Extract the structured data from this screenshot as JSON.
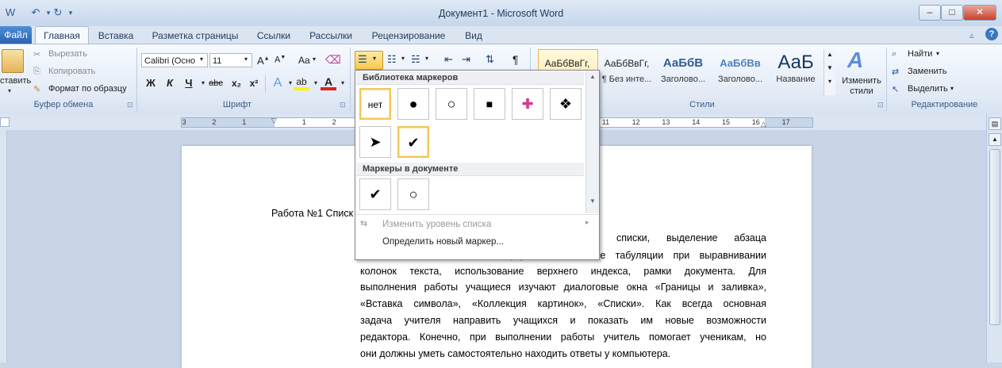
{
  "window": {
    "title": "Документ1  -  Microsoft Word",
    "buttons": {
      "minimize": "–",
      "maximize": "□",
      "close": "✕"
    }
  },
  "tabs": [
    "Файл",
    "Главная",
    "Вставка",
    "Разметка страницы",
    "Ссылки",
    "Рассылки",
    "Рецензирование",
    "Вид"
  ],
  "clipboard": {
    "paste": "ставить",
    "cut": "Вырезать",
    "copy": "Копировать",
    "format_painter": "Формат по образцу",
    "label": "Буфер обмена"
  },
  "font": {
    "name": "Calibri (Осно",
    "size": "11",
    "label": "Шрифт",
    "bold": "Ж",
    "italic": "К",
    "underline": "Ч",
    "strike": "abc",
    "sub": "x₂",
    "sup": "x²",
    "grow": "A▲",
    "shrink": "A▼",
    "case": "Aa"
  },
  "styles": {
    "label": "Стили",
    "items": [
      {
        "sample": "АаБбВвГг,",
        "name": ""
      },
      {
        "sample": "АаБбВвГг,",
        "name": "¶ Без инте..."
      },
      {
        "sample": "АаБбВ",
        "name": "Заголово..."
      },
      {
        "sample": "АаБбВв",
        "name": "Заголово..."
      },
      {
        "sample": "АаБ",
        "name": "Название"
      }
    ],
    "change_styles": [
      "Изменить",
      "стили"
    ]
  },
  "editing": {
    "label": "Редактирование",
    "find": "Найти",
    "replace": "Заменить",
    "select": "Выделить"
  },
  "bullets_dropdown": {
    "library_header": "Библиотека маркеров",
    "library": [
      "нет",
      "●",
      "○",
      "■",
      "✚",
      "❖",
      "➤",
      "✔"
    ],
    "doc_header": "Маркеры в документе",
    "document_markers": [
      "✔",
      "○"
    ],
    "change_level": "Изменить уровень списка",
    "define_new": "Определить новый маркер..."
  },
  "ruler_numbers": [
    "3",
    "2",
    "1",
    "1",
    "2",
    "3",
    "4",
    "5",
    "6",
    "7",
    "8",
    "9",
    "10",
    "11",
    "12",
    "13",
    "14",
    "15",
    "16",
    "17"
  ],
  "document": {
    "heading": "Работа №1 Списк",
    "lines": [
      "нты: списки, выделение абзаца",
      "заливкой, вставка символа (✔), использование табуляции при выравнивании",
      "колонок текста, использование верхнего индекса, рамки документа. Для",
      "выполнения работы учащиеся изучают диалоговые окна «Границы и заливка»,",
      "«Вставка символа», «Коллекция картинок», «Списки». Как всегда основная",
      "задача учителя направить учащихся и показать им новые возможности",
      "редактора. Конечно, при выполнении  работы учитель помогает ученикам, но",
      "они должны уметь самостоятельно находить ответы у компьютера."
    ]
  }
}
